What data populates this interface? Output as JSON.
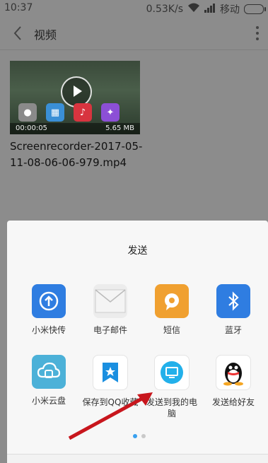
{
  "status_bar": {
    "time": "10:37",
    "speed": "0.53K/s",
    "carrier": "移动"
  },
  "header": {
    "title": "视频"
  },
  "video": {
    "duration": "00:00:05",
    "size": "5.65 MB",
    "filename": "Screenrecorder-2017-05-11-08-06-06-979.mp4"
  },
  "sheet": {
    "title": "发送",
    "apps": [
      {
        "label": "小米快传",
        "icon": "mi-drop-icon",
        "color": "#2f7de1"
      },
      {
        "label": "电子邮件",
        "icon": "email-icon",
        "color": "#ececec"
      },
      {
        "label": "短信",
        "icon": "sms-icon",
        "color": "#f0a030"
      },
      {
        "label": "蓝牙",
        "icon": "bluetooth-icon",
        "color": "#2f7de1"
      },
      {
        "label": "小米云盘",
        "icon": "mi-cloud-icon",
        "color": "#4cb1d8"
      },
      {
        "label": "保存到QQ收藏",
        "icon": "qq-favorite-icon",
        "color": "#ffffff"
      },
      {
        "label": "发送到我的电脑",
        "icon": "my-computer-icon",
        "color": "#ffffff"
      },
      {
        "label": "发送给好友",
        "icon": "qq-icon",
        "color": "#ffffff"
      }
    ],
    "page_indicator": {
      "current": 1,
      "total": 2
    }
  }
}
